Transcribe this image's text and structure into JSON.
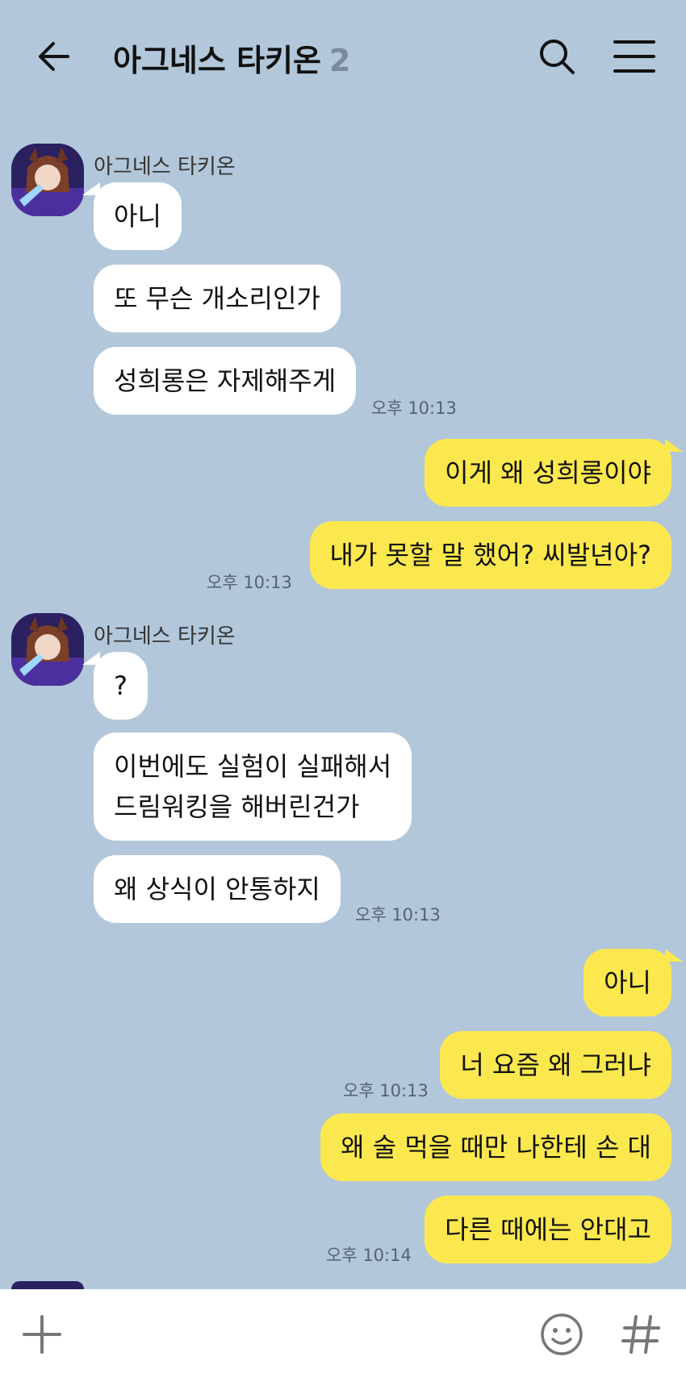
{
  "header": {
    "title": "아그네스 타키온",
    "member_count": "2",
    "icons": [
      "back-arrow-icon",
      "search-icon",
      "menu-icon"
    ]
  },
  "messages": [
    {
      "side": "in",
      "sender": "아그네스 타키온",
      "text": "아니"
    },
    {
      "side": "in",
      "text": "또 무슨 개소리인가"
    },
    {
      "side": "in",
      "text": "성희롱은 자제해주게",
      "time": "오후 10:13"
    },
    {
      "side": "out",
      "text": "이게 왜 성희롱이야"
    },
    {
      "side": "out",
      "text": "내가 못할 말 했어? 씨발년아?",
      "time": "오후 10:13"
    },
    {
      "side": "in",
      "sender": "아그네스 타키온",
      "text": "?"
    },
    {
      "side": "in",
      "text_lines": [
        "이번에도 실험이 실패해서",
        "드림워킹을 해버린건가"
      ]
    },
    {
      "side": "in",
      "text": "왜 상식이 안통하지",
      "time": "오후 10:13"
    },
    {
      "side": "out",
      "text": "아니"
    },
    {
      "side": "out",
      "text": "너 요즘 왜 그러냐",
      "time": "오후 10:13"
    },
    {
      "side": "out",
      "text": "왜 술 먹을 때만 나한테 손 대"
    },
    {
      "side": "out",
      "text": "다른 때에는 안대고",
      "time": "오후 10:14"
    }
  ],
  "input_bar": {
    "icons": [
      "plus-icon",
      "emoji-icon",
      "hashtag-icon"
    ]
  },
  "colors": {
    "background": "#b2c7da",
    "incoming_bubble": "#ffffff",
    "outgoing_bubble": "#fbe84e"
  }
}
